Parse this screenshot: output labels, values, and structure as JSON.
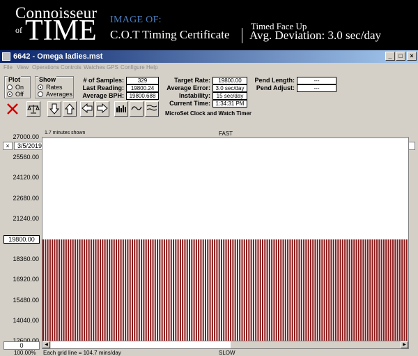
{
  "banner": {
    "logo_line1": "Connoisseur",
    "logo_of": "of",
    "logo_line2": "TIME",
    "image_of": "IMAGE OF:",
    "certificate": "C.O.T Timing Certificate",
    "timed_face": "Timed Face Up",
    "avg_deviation": "Avg. Deviation:  3.0 sec/day"
  },
  "window": {
    "title": "6642 - Omega ladies.mst",
    "buttons": {
      "minimize": "_",
      "maximize": "□",
      "close": "×"
    }
  },
  "menu": [
    "File",
    "View",
    "Operations",
    "Controls",
    "Watches",
    "GPS",
    "Configure",
    "Help"
  ],
  "plot_group": {
    "title": "Plot",
    "options": [
      "On",
      "Off"
    ],
    "selected": "Off"
  },
  "show_group": {
    "title": "Show",
    "options": [
      "Rates",
      "Averages"
    ],
    "selected": "Rates"
  },
  "stats": {
    "samples_label": "# of Samples:",
    "samples": "329",
    "last_reading_label": "Last Reading:",
    "last_reading": "19800.24",
    "average_bph_label": "Average BPH:",
    "average_bph": "19800.688",
    "target_rate_label": "Target Rate:",
    "target_rate": "19800.00",
    "average_error_label": "Average Error:",
    "average_error": "3.0 sec/day",
    "instability_label": "Instability:",
    "instability": "15 sec/day",
    "current_time_label": "Current Time:",
    "current_time": "1:34:31 PM",
    "pend_length_label": "Pend Length:",
    "pend_length": "---",
    "pend_adjust_label": "Pend Adjust:",
    "pend_adjust": "---"
  },
  "caption": "MicroSet Clock and Watch Timer",
  "toolbar_icons": [
    "delete-x-icon",
    "balance-scale-icon",
    "arrow-down-icon",
    "arrow-up-icon",
    "arrow-left-icon",
    "arrow-right-icon",
    "bar-chart-icon",
    "wave-icon",
    "lines-icon"
  ],
  "date": {
    "close": "×",
    "value": "3/5/2019"
  },
  "chart": {
    "minutes_shown": "1.7 minutes shown",
    "top_label": "FAST",
    "bottom_label": "SLOW",
    "zero_box": "0",
    "zoom": "100.00%",
    "grid_note": "Each grid line = 104.7 mins/day",
    "bar_color": "#8b1a1a",
    "y_ticks": [
      "27000.00",
      "25560.00",
      "24120.00",
      "22680.00",
      "21240.00",
      "19800.00",
      "18360.00",
      "16920.00",
      "15480.00",
      "14040.00",
      "12600.00"
    ],
    "highlight_tick": "19800.00"
  },
  "chart_data": {
    "type": "bar",
    "title": "",
    "xlabel": "",
    "ylabel": "",
    "ylim": [
      12600,
      27000
    ],
    "sample_count": 329,
    "visible_bars": 160,
    "values_note": "All readings approximately 19800 BPH",
    "value": 19800.24
  }
}
